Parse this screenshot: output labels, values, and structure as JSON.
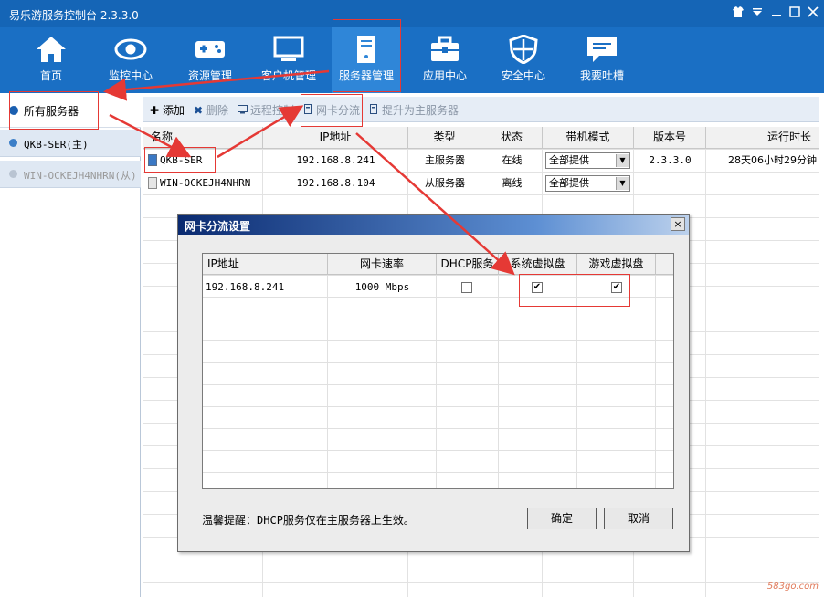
{
  "window": {
    "title": "易乐游服务控制台 2.3.3.0",
    "controls": [
      "shirt-icon",
      "menu-icon",
      "minimize-icon",
      "maximize-icon",
      "close-icon"
    ]
  },
  "nav": {
    "items": [
      {
        "label": "首页",
        "icon": "home-icon"
      },
      {
        "label": "监控中心",
        "icon": "eye-icon"
      },
      {
        "label": "资源管理",
        "icon": "gamepad-icon"
      },
      {
        "label": "客户机管理",
        "icon": "monitor-icon"
      },
      {
        "label": "服务器管理",
        "icon": "server-icon",
        "active": true
      },
      {
        "label": "应用中心",
        "icon": "toolbox-icon"
      },
      {
        "label": "安全中心",
        "icon": "shield-icon"
      },
      {
        "label": "我要吐槽",
        "icon": "chat-icon"
      }
    ]
  },
  "sidebar": {
    "header": "所有服务器",
    "items": [
      {
        "label": "QKB-SER(主)",
        "disabled": false
      },
      {
        "label": "WIN-OCKEJH4NHRN(从)",
        "disabled": true
      }
    ]
  },
  "toolbar": {
    "buttons": [
      {
        "label": "添加",
        "icon": "plus-icon",
        "disabled": false
      },
      {
        "label": "删除",
        "icon": "x-icon",
        "disabled": true
      },
      {
        "label": "远程控制",
        "icon": "remote-icon",
        "disabled": true
      },
      {
        "label": "网卡分流",
        "icon": "nic-icon",
        "disabled": true
      },
      {
        "label": "提升为主服务器",
        "icon": "promote-icon",
        "disabled": true
      }
    ]
  },
  "server_table": {
    "columns": [
      "名称",
      "IP地址",
      "类型",
      "状态",
      "带机模式",
      "版本号",
      "运行时长"
    ],
    "rows": [
      {
        "name": "QKB-SER",
        "ip": "192.168.8.241",
        "type": "主服务器",
        "status": "在线",
        "mode": "全部提供",
        "version": "2.3.3.0",
        "uptime": "28天06小时29分钟"
      },
      {
        "name": "WIN-OCKEJH4NHRN",
        "ip": "192.168.8.104",
        "type": "从服务器",
        "status": "离线",
        "mode": "全部提供",
        "version": "",
        "uptime": ""
      }
    ]
  },
  "dialog": {
    "title": "网卡分流设置",
    "close": "×",
    "columns": [
      "IP地址",
      "网卡速率",
      "DHCP服务",
      "系统虚拟盘",
      "游戏虚拟盘"
    ],
    "rows": [
      {
        "ip": "192.168.8.241",
        "speed": "1000 Mbps",
        "dhcp": false,
        "sys_disk": true,
        "game_disk": true
      }
    ],
    "note_prefix": "温馨提醒：",
    "note_mono": "DHCP",
    "note_suffix": "服务仅在主服务器上生效。",
    "ok": "确定",
    "cancel": "取消"
  },
  "glyphs": {
    "check": "✔",
    "combo_arrow": "▼"
  },
  "watermark": "583go.com",
  "colors": {
    "titlebar": "#1565b6",
    "nav": "#1a6fc4",
    "nav_active": "#2f86d8",
    "annotation": "#e53935"
  }
}
